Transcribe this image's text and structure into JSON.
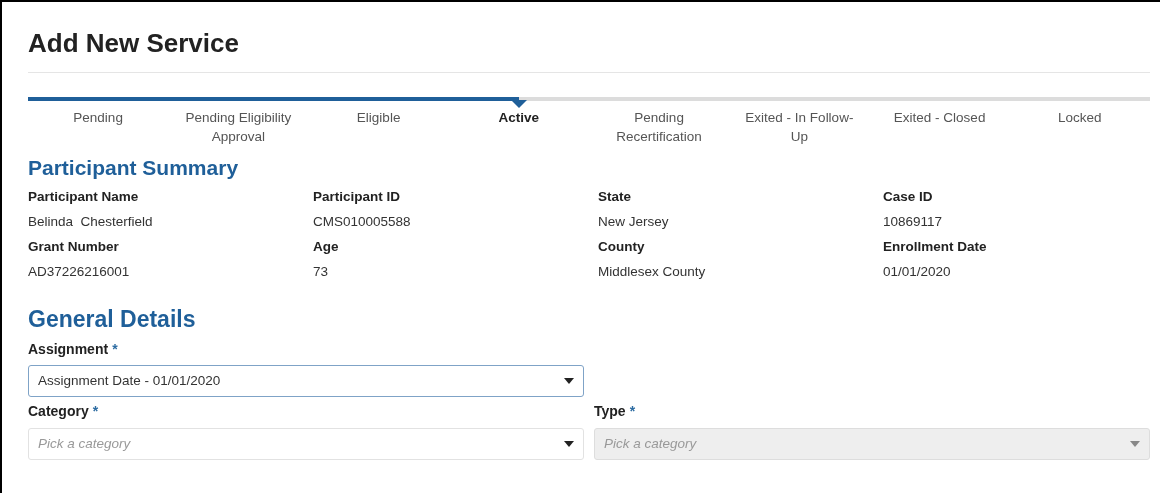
{
  "page_title": "Add New Service",
  "steps": [
    {
      "label": "Pending",
      "selected": false
    },
    {
      "label": "Pending Eligibility Approval",
      "selected": false
    },
    {
      "label": "Eligible",
      "selected": false
    },
    {
      "label": "Active",
      "selected": true
    },
    {
      "label": "Pending Recertification",
      "selected": false
    },
    {
      "label": "Exited - In Follow-Up",
      "selected": false
    },
    {
      "label": "Exited - Closed",
      "selected": false
    },
    {
      "label": "Locked",
      "selected": false
    }
  ],
  "participant_summary": {
    "heading": "Participant Summary",
    "fields": [
      {
        "label": "Participant Name",
        "value": "Belinda  Chesterfield"
      },
      {
        "label": "Participant ID",
        "value": "CMS010005588"
      },
      {
        "label": "State",
        "value": "New Jersey"
      },
      {
        "label": "Case ID",
        "value": "10869117"
      },
      {
        "label": "Grant Number",
        "value": "AD37226216001"
      },
      {
        "label": "Age",
        "value": "73"
      },
      {
        "label": "County",
        "value": "Middlesex County"
      },
      {
        "label": "Enrollment Date",
        "value": "01/01/2020"
      }
    ]
  },
  "general_details": {
    "heading": "General Details",
    "assignment": {
      "label": "Assignment",
      "required_mark": "*",
      "value": "Assignment Date - 01/01/2020",
      "disabled": false
    },
    "category": {
      "label": "Category",
      "required_mark": "*",
      "placeholder": "Pick a category",
      "disabled": false
    },
    "type": {
      "label": "Type",
      "required_mark": "*",
      "placeholder": "Pick a category",
      "disabled": true
    }
  }
}
